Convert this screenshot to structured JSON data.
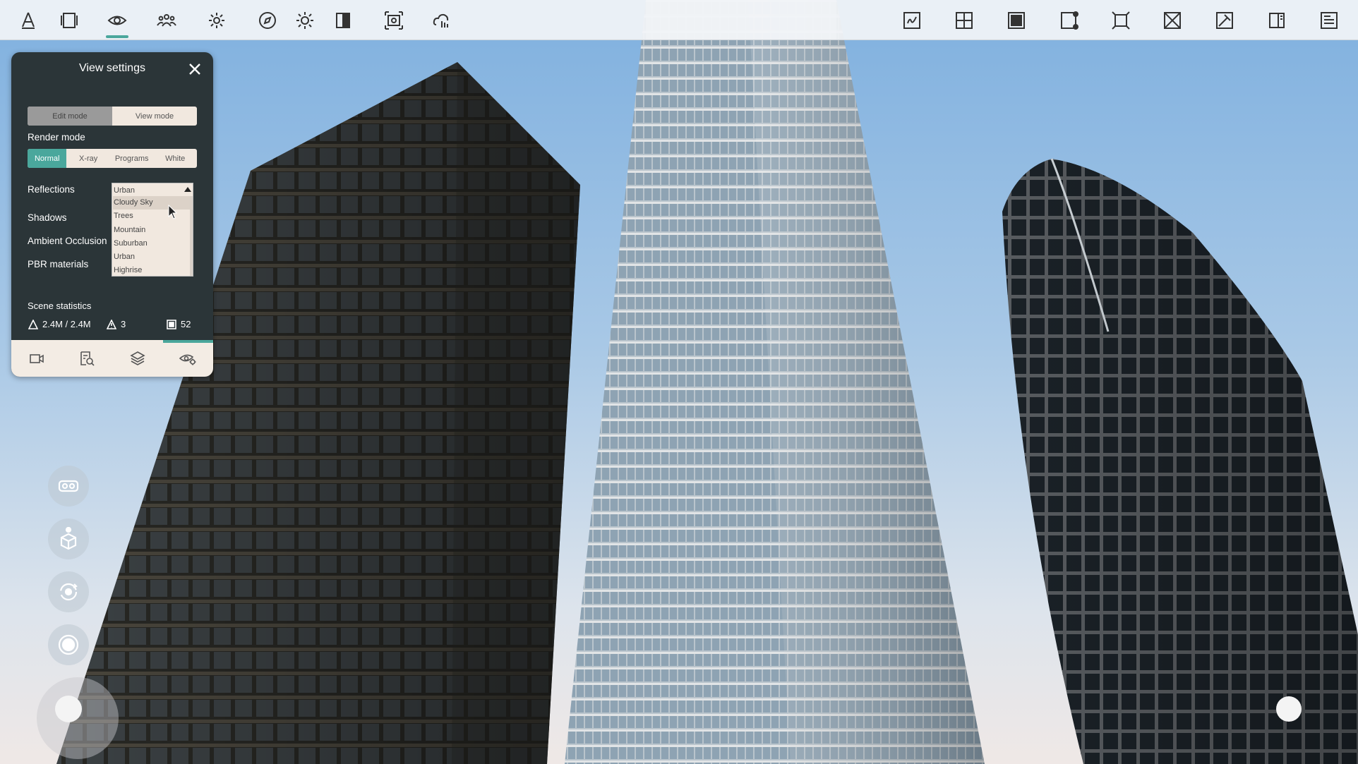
{
  "toolbar": {
    "left_icons": [
      "architecture-tool-icon",
      "panels-icon",
      "eye-icon",
      "people-icon",
      "settings-gear-icon",
      "compass-icon",
      "sun-icon",
      "mirror-icon",
      "screenshot-icon",
      "cloud-upload-icon"
    ],
    "active": "eye-icon",
    "right_icons": [
      "sketch-icon",
      "grid-plus-icon",
      "solid-square-icon",
      "select-corner-icon",
      "fit-view-icon",
      "cross-box-icon",
      "pin-icon",
      "split-view-icon",
      "document-list-icon"
    ]
  },
  "panel": {
    "title": "View settings",
    "mode": {
      "edit": "Edit mode",
      "view": "View mode"
    },
    "render_mode_label": "Render mode",
    "render_modes": {
      "normal": "Normal",
      "xray": "X-ray",
      "programs": "Programs",
      "white": "White"
    },
    "reflections_label": "Reflections",
    "shadows_label": "Shadows",
    "ao_label": "Ambient Occlusion",
    "pbr_label": "PBR materials",
    "dropdown": {
      "selected": "Urban",
      "options": [
        "Cloudy Sky",
        "Trees",
        "Mountain",
        "Suburban",
        "Urban",
        "Highrise"
      ],
      "hovered": "Cloudy Sky"
    },
    "stats": {
      "title": "Scene statistics",
      "triangles": "2.4M / 2.4M",
      "warnings": "3",
      "objects": "52"
    },
    "tabs": [
      "video-camera-icon",
      "search-document-icon",
      "layers-icon",
      "eye-settings-icon"
    ],
    "active_tab": "eye-settings-icon"
  },
  "floating": [
    "vr-headset-icon",
    "walk-mode-icon",
    "orbit-icon",
    "record-icon"
  ],
  "colors": {
    "accent": "#4aa79c",
    "panel_bg": "#2b3538",
    "segment_bg": "#f1e8df",
    "toolbar_bg": "#f2f4f7"
  }
}
